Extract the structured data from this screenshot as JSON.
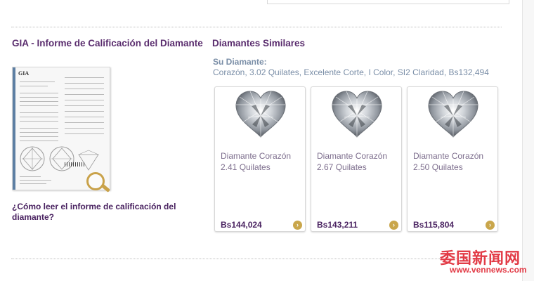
{
  "left": {
    "title": "GIA - Informe de Calificación del Diamante",
    "certificate_logo": "GIA",
    "link": "¿Cómo leer el informe de calificación del diamante?"
  },
  "right": {
    "title": "Diamantes Similares",
    "your_label": "Su Diamante:",
    "your_desc": "Corazón, 3.02 Quilates, Excelente Corte, I Color, SI2 Claridad, Bs132,494",
    "cards": [
      {
        "name": "Diamante Corazón",
        "carat": "2.41 Quilates",
        "price": "Bs144,024"
      },
      {
        "name": "Diamante Corazón",
        "carat": "2.67 Quilates",
        "price": "Bs143,211"
      },
      {
        "name": "Diamante Corazón",
        "carat": "2.50 Quilates",
        "price": "Bs115,804"
      }
    ]
  },
  "watermark": {
    "line1": "委国新闻网",
    "line2": "www.vennews.com"
  },
  "colors": {
    "accent": "#5a2d6e",
    "muted": "#7a8ea7",
    "gold": "#c9a64b",
    "watermark": "#e23b46"
  }
}
